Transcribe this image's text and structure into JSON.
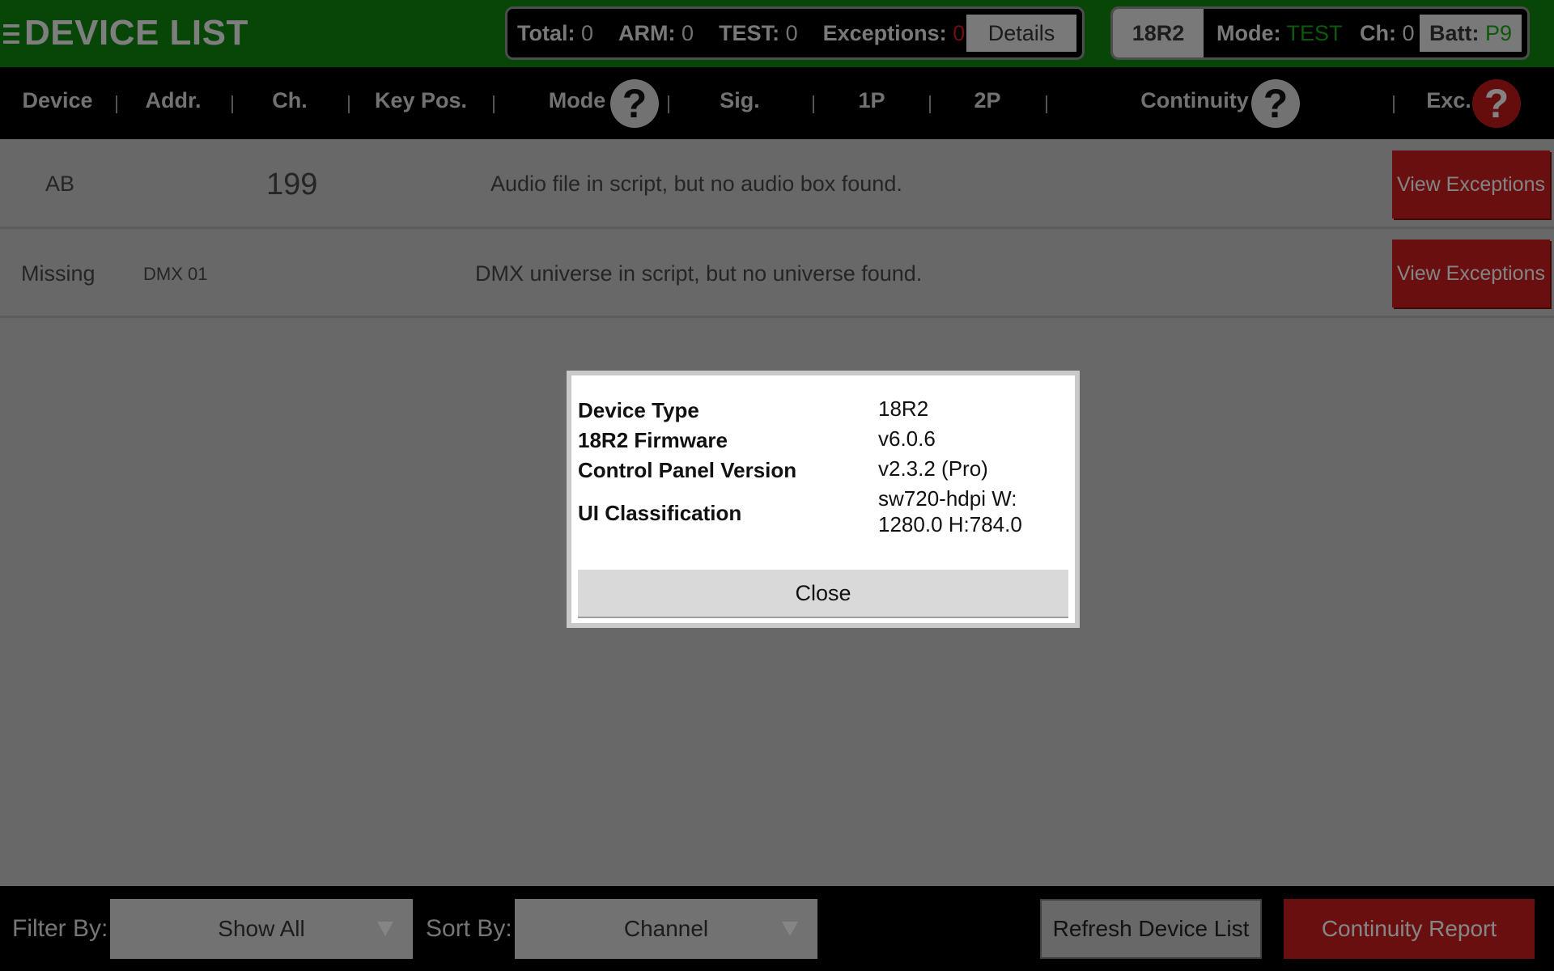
{
  "app": {
    "title": "DEVICE LIST"
  },
  "stats": {
    "total_label": "Total:",
    "total_value": "0",
    "arm_label": "ARM:",
    "arm_value": "0",
    "test_label": "TEST:",
    "test_value": "0",
    "exceptions_label": "Exceptions:",
    "exceptions_value": "0",
    "details_button": "Details"
  },
  "device_status": {
    "name": "18R2",
    "mode_label": "Mode:",
    "mode_value": "TEST",
    "ch_label": "Ch:",
    "ch_value": "0",
    "batt_label": "Batt:",
    "batt_value": "P9"
  },
  "columns": [
    "Device",
    "Addr.",
    "Ch.",
    "Key Pos.",
    "Mode",
    "Sig.",
    "1P",
    "2P",
    "Continuity",
    "Exc."
  ],
  "rows": [
    {
      "device": "AB",
      "address": "",
      "channel": "199",
      "message": "Audio file in script, but no audio box found.",
      "action": "View Exceptions"
    },
    {
      "device": "Missing",
      "address": "DMX 01",
      "channel": "",
      "message": "DMX universe in script, but no universe found.",
      "action": "View Exceptions"
    }
  ],
  "bottom": {
    "filter_label": "Filter By:",
    "filter_value": "Show All",
    "sort_label": "Sort By:",
    "sort_value": "Channel",
    "refresh_button": "Refresh Device List",
    "report_button": "Continuity Report"
  },
  "dialog": {
    "items": [
      {
        "label": "Device Type",
        "value": "18R2"
      },
      {
        "label": "18R2 Firmware",
        "value": "v6.0.6"
      },
      {
        "label": "Control Panel Version",
        "value": "v2.3.2 (Pro)"
      },
      {
        "label": "UI Classification",
        "value_line1": "sw720-hdpi W:",
        "value_line2": "1280.0 H:784.0"
      }
    ],
    "close_button": "Close"
  },
  "colors": {
    "topbar": "#0d800d",
    "accent_red": "#c01c1c",
    "status_green": "#17a317"
  },
  "icons": [
    "menu-icon",
    "help-icon",
    "dropdown-arrow-icon"
  ]
}
